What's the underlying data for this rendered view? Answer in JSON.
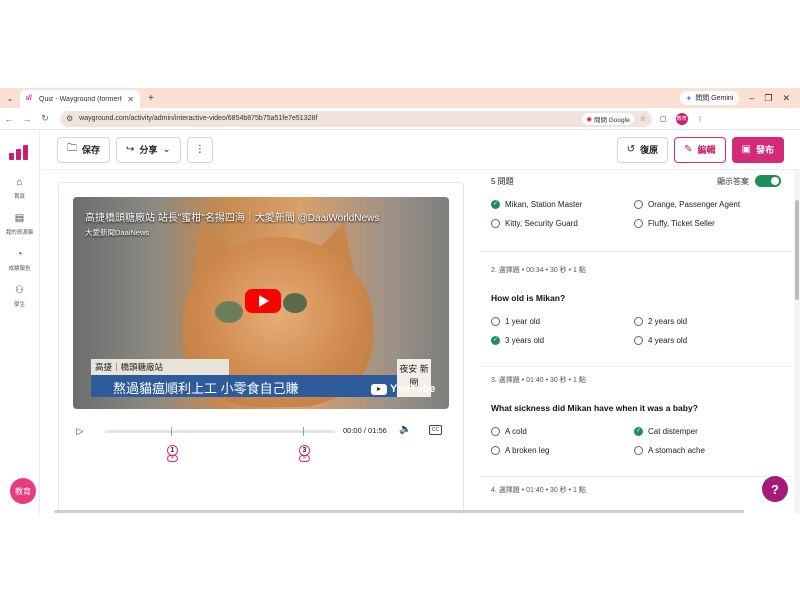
{
  "browser": {
    "tab_title": "Quiz - Wayground (formerly Q",
    "gemini_label": "問問 Gemini",
    "url": "wayground.com/activity/admin/interactive-video/6854b875b75a51fe7e51328f",
    "google_lens_label": "問問 Google",
    "avatar_text": "教育"
  },
  "nav": {
    "items": [
      {
        "label": "首頁",
        "icon": "home-icon",
        "glyph": "⌂"
      },
      {
        "label": "我的資源庫",
        "icon": "library-icon",
        "glyph": "▤"
      },
      {
        "label": "成績報告",
        "icon": "report-icon",
        "glyph": "◔"
      },
      {
        "label": "學生",
        "icon": "students-icon",
        "glyph": "⚇"
      }
    ],
    "badge": "教育"
  },
  "toolbar": {
    "save_label": "保存",
    "share_label": "分享",
    "restore_label": "復原",
    "edit_label": "編輯",
    "publish_label": "發布"
  },
  "video": {
    "title": "高捷橋頭糖廠站 站長\"蜜柑\"名揚四海｜大愛新聞 @DaaiWorldNews",
    "channel": "大愛新聞DaaiNews",
    "lower_third_top": "高捷｜橋頭糖廠站",
    "lower_third_main": "熬過貓瘟順利上工 小零食自己賺",
    "station_tag": "夜安 新聞",
    "yt_label": "YouTube",
    "time": "00:00 / 01:56",
    "markers": [
      {
        "num": "1",
        "sym": "✕"
      },
      {
        "num": "3",
        "sym": "✕"
      }
    ]
  },
  "questions_panel": {
    "count_label": "5 問題",
    "show_answers_label": "顯示答案",
    "cards": [
      {
        "meta": "",
        "text": "",
        "options": [
          {
            "label": "Mikan, Station Master",
            "correct": true
          },
          {
            "label": "Orange, Passenger Agent",
            "correct": false
          },
          {
            "label": "Kitty, Security Guard",
            "correct": false
          },
          {
            "label": "Fluffy, Ticket Seller",
            "correct": false
          }
        ]
      },
      {
        "meta": "2. 選擇題 • 00:34 • 30 秒 • 1 點",
        "text": "How old is Mikan?",
        "options": [
          {
            "label": "1 year old",
            "correct": false
          },
          {
            "label": "2 years old",
            "correct": false
          },
          {
            "label": "3 years old",
            "correct": true
          },
          {
            "label": "4 years old",
            "correct": false
          }
        ]
      },
      {
        "meta": "3. 選擇題 • 01:40 • 30 秒 • 1 點",
        "text": "What sickness did Mikan have when it was a baby?",
        "options": [
          {
            "label": "A cold",
            "correct": false
          },
          {
            "label": "Cat distemper",
            "correct": true
          },
          {
            "label": "A broken leg",
            "correct": false
          },
          {
            "label": "A stomach ache",
            "correct": false
          }
        ]
      },
      {
        "meta": "4. 選擇題 • 01:40 • 30 秒 • 1 點",
        "text": "",
        "options": []
      }
    ]
  },
  "colors": {
    "brand": "#d42a78",
    "correct": "#1e8e5a",
    "chrome_tab": "#fbe0d4"
  }
}
